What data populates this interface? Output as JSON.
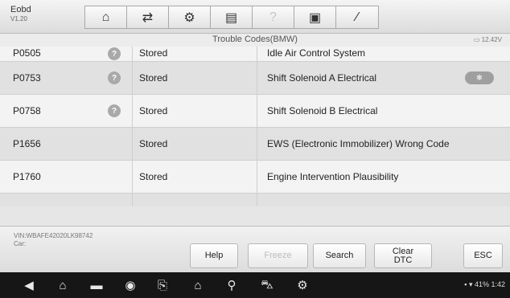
{
  "app": {
    "name": "Eobd",
    "version": "V1.20"
  },
  "toolbar": {
    "icons": [
      "home-icon",
      "vehicle-swap-icon",
      "settings-icon",
      "print-icon",
      "help-icon",
      "save-icon",
      "pen-icon"
    ]
  },
  "table": {
    "title": "Trouble Codes(BMW)",
    "battery": "12.42V"
  },
  "rows": [
    {
      "code": "P0505",
      "status": "Stored",
      "desc": "Idle Air Control System"
    },
    {
      "code": "P0753",
      "status": "Stored",
      "desc": "Shift Solenoid A Electrical"
    },
    {
      "code": "P0758",
      "status": "Stored",
      "desc": "Shift Solenoid B Electrical"
    },
    {
      "code": "P1656",
      "status": "Stored",
      "desc": "EWS (Electronic Immobilizer) Wrong Code"
    },
    {
      "code": "P1760",
      "status": "Stored",
      "desc": "Engine Intervention Plausibility"
    }
  ],
  "footer": {
    "vin": "VIN:WBAFE42020LK98742",
    "car": "Car:"
  },
  "buttons": {
    "help": "Help",
    "freeze": "Freeze",
    "search": "Search",
    "clear": "Clear\nDTC",
    "esc": "ESC"
  },
  "statusbar": {
    "text": "41% 1:42"
  }
}
